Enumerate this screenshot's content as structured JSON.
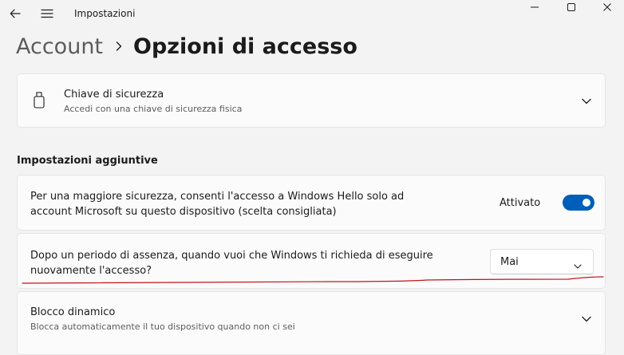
{
  "window": {
    "title": "Impostazioni",
    "accent_color": "#005fb8",
    "annotation_color": "#c0141c"
  },
  "breadcrumb": {
    "parent": "Account",
    "current": "Opzioni di accesso"
  },
  "security_key": {
    "title": "Chiave di sicurezza",
    "subtitle": "Accedi con una chiave di sicurezza fisica",
    "icon": "usb-key-icon"
  },
  "additional_settings": {
    "heading": "Impostazioni aggiuntive",
    "hello_only": {
      "text": "Per una maggiore sicurezza, consenti l'accesso a Windows Hello solo ad account Microsoft su questo dispositivo (scelta consigliata)",
      "toggle_label": "Attivato",
      "toggle_on": true
    },
    "absence": {
      "text": "Dopo un periodo di assenza, quando vuoi che Windows ti richieda di eseguire nuovamente l'accesso?",
      "selected": "Mai"
    },
    "dynamic_lock": {
      "title": "Blocco dinamico",
      "subtitle": "Blocca automaticamente il tuo dispositivo quando non ci sei"
    }
  }
}
